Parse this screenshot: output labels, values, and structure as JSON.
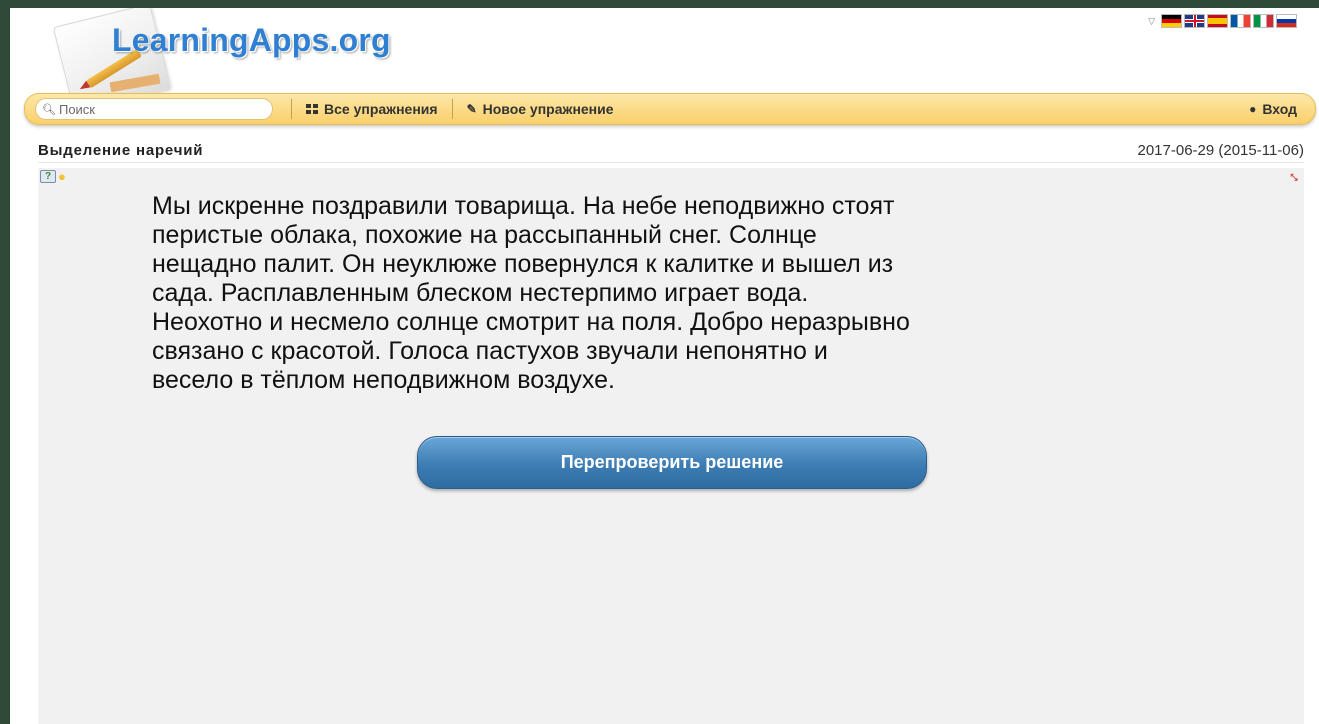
{
  "logo": {
    "text": "LearningApps.org"
  },
  "languages": [
    "de",
    "gb",
    "es",
    "fr",
    "it",
    "ru"
  ],
  "toolbar": {
    "search_placeholder": "Поиск",
    "all_exercises": "Все упражнения",
    "new_exercise": "Новое упражнение",
    "login": "Вход"
  },
  "page": {
    "title": "Выделение наречий",
    "date": "2017-06-29 (2015-11-06)"
  },
  "exercise": {
    "lines": [
      "Мы искренне поздравили товарища. На небе неподвижно стоят",
      "перистые облака, похожие на рассыпанный снег. Солнце",
      "нещадно палит. Он неуклюже повернулся к калитке и вышел из",
      "сада. Расплавленным блеском нестерпимо играет вода.",
      "Неохотно и несмело солнце смотрит на поля. Добро неразрывно",
      "связано с красотой. Голоса пастухов звучали непонятно и",
      "весело в тёплом неподвижном воздухе."
    ],
    "button_label": "Перепроверить решение"
  },
  "colors": {
    "toolbar": "#f9cf6a",
    "logo": "#2f7fd3",
    "button": "#3d7db3",
    "app_background": "#f1f1f1"
  }
}
